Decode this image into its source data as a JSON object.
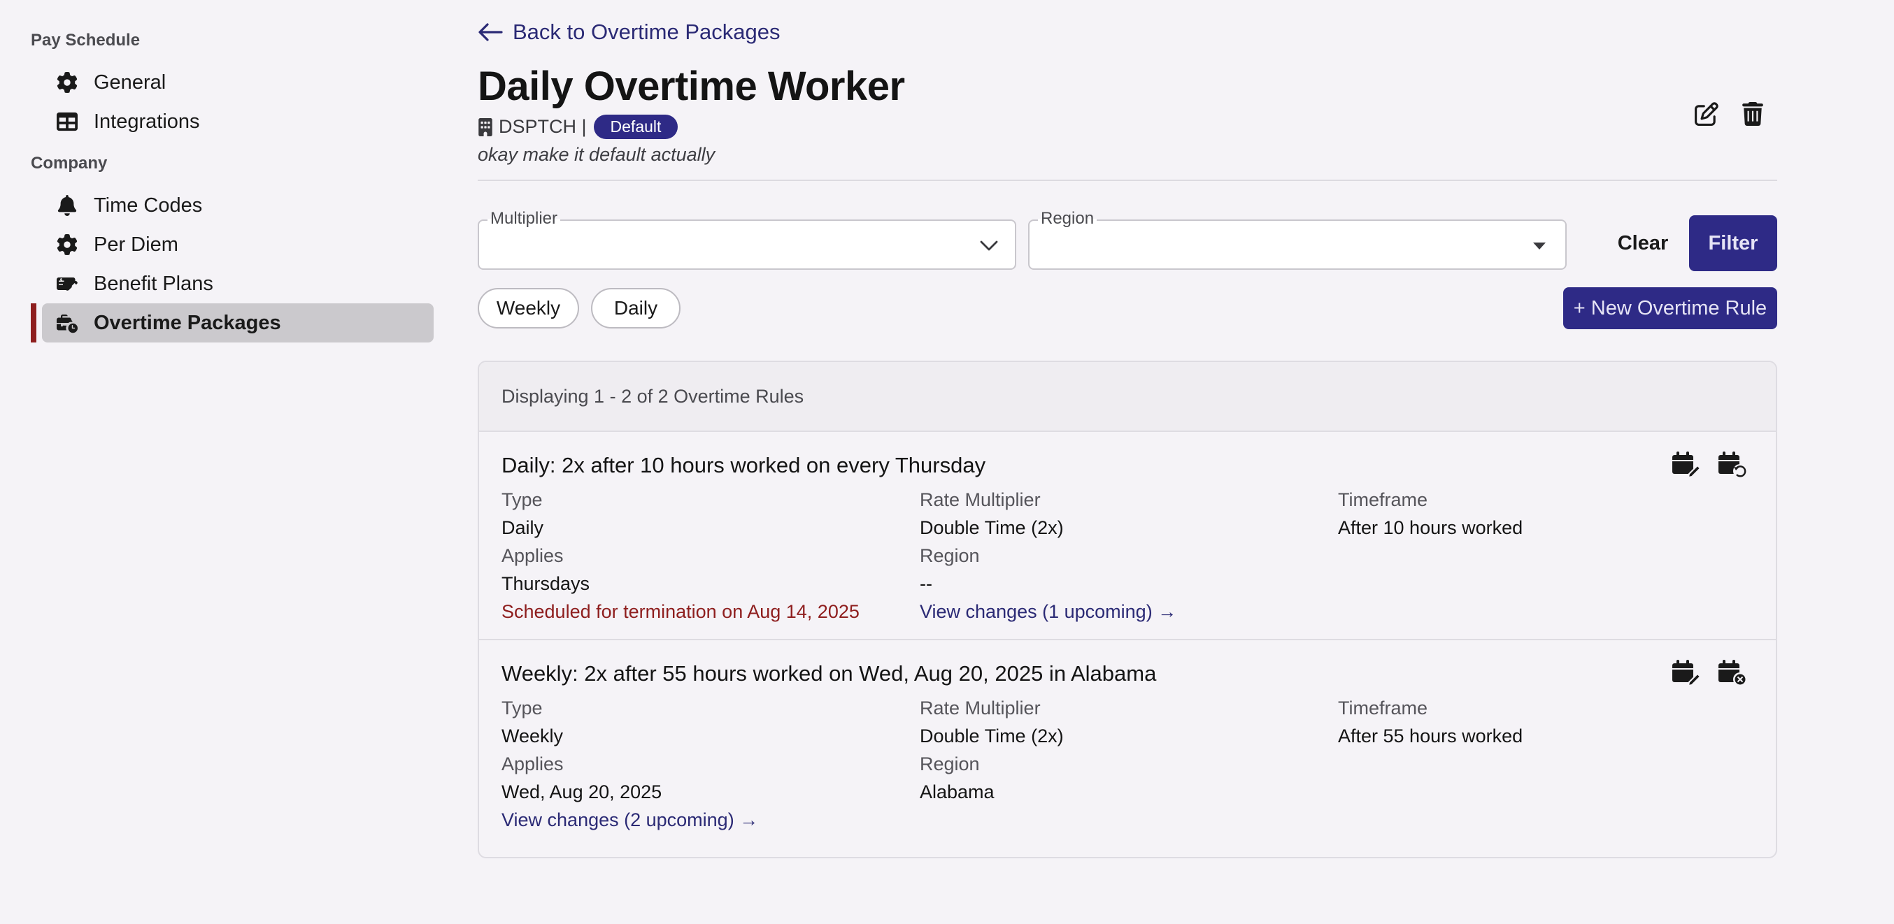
{
  "sidebar": {
    "sections": [
      {
        "title": "Pay Schedule",
        "items": [
          {
            "label": "General",
            "icon": "gear-icon"
          },
          {
            "label": "Integrations",
            "icon": "table-icon"
          }
        ]
      },
      {
        "title": "Company",
        "items": [
          {
            "label": "Time Codes",
            "icon": "bell-icon"
          },
          {
            "label": "Per Diem",
            "icon": "gear-icon"
          },
          {
            "label": "Benefit Plans",
            "icon": "money-check-icon"
          },
          {
            "label": "Overtime Packages",
            "icon": "briefcase-clock-icon",
            "active": true
          }
        ]
      }
    ]
  },
  "header": {
    "back_label": "Back to Overtime Packages",
    "title": "Daily Overtime Worker",
    "company": "DSPTCH |",
    "badge": "Default",
    "description": "okay make it default actually",
    "actions": [
      "edit-icon",
      "trash-icon"
    ]
  },
  "filters": {
    "multiplier_label": "Multiplier",
    "multiplier_value": "",
    "region_label": "Region",
    "region_value": "",
    "clear_label": "Clear",
    "filter_label": "Filter",
    "chips": [
      "Weekly",
      "Daily"
    ],
    "new_rule_label": "+ New Overtime Rule"
  },
  "list": {
    "summary": "Displaying 1 - 2 of 2 Overtime Rules",
    "rules": [
      {
        "title": "Daily: 2x after 10 hours worked on every Thursday",
        "type_label": "Type",
        "type": "Daily",
        "rate_label": "Rate Multiplier",
        "rate": "Double Time (2x)",
        "timeframe_label": "Timeframe",
        "timeframe": "After 10 hours worked",
        "applies_label": "Applies",
        "applies": "Thursdays",
        "region_label": "Region",
        "region": "--",
        "termination": "Scheduled for termination on Aug 14, 2025",
        "changes_link": "View changes (1 upcoming) →",
        "actions": [
          "calendar-edit-icon",
          "calendar-restore-icon"
        ]
      },
      {
        "title": "Weekly: 2x after 55 hours worked on Wed, Aug 20, 2025 in Alabama",
        "type_label": "Type",
        "type": "Weekly",
        "rate_label": "Rate Multiplier",
        "rate": "Double Time (2x)",
        "timeframe_label": "Timeframe",
        "timeframe": "After 55 hours worked",
        "applies_label": "Applies",
        "applies": "Wed, Aug 20, 2025",
        "region_label": "Region",
        "region": "Alabama",
        "changes_link": "View changes (2 upcoming) →",
        "actions": [
          "calendar-edit-icon",
          "calendar-cancel-icon"
        ]
      }
    ]
  },
  "colors": {
    "accent": "#2e2a86",
    "danger": "#8e1e1e",
    "link": "#2b2a75",
    "background": "#f5f3f7",
    "sidebar_active": "#cbc9cd"
  }
}
